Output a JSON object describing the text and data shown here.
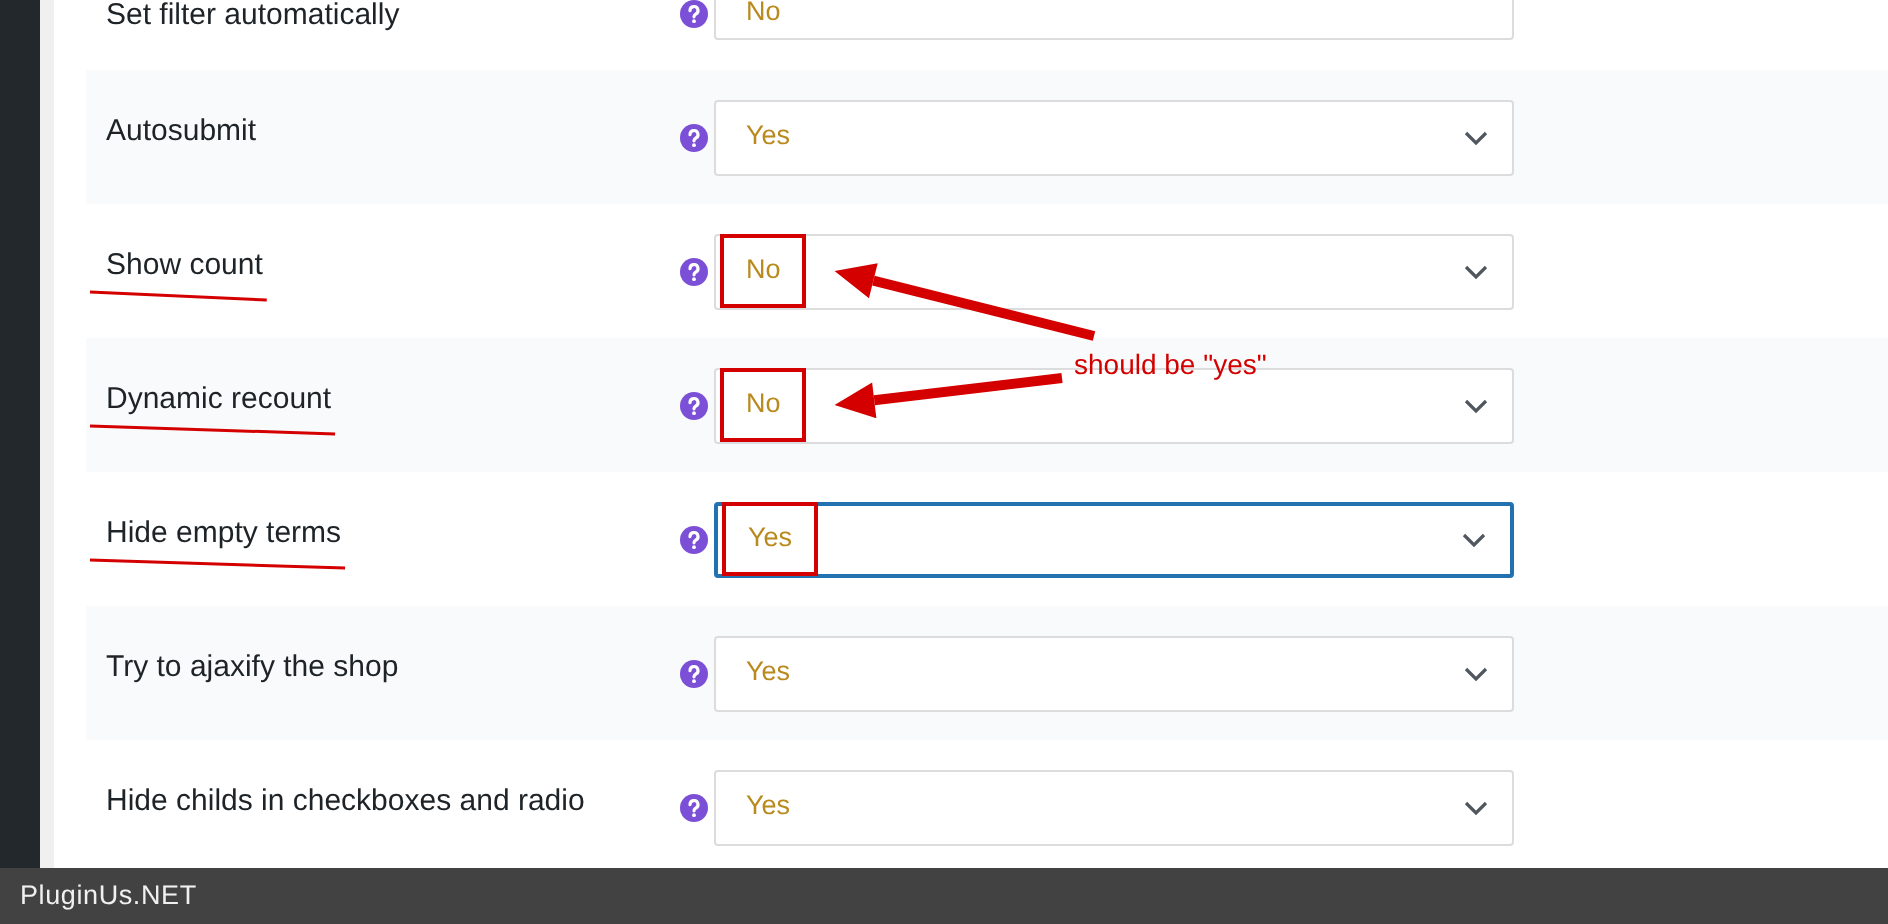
{
  "settings": [
    {
      "label": "Set filter automatically",
      "value": "No",
      "focused": false,
      "underlined": false,
      "highlighted": false,
      "arrow": false
    },
    {
      "label": "Autosubmit",
      "value": "Yes",
      "focused": false,
      "underlined": false,
      "highlighted": false,
      "arrow": false
    },
    {
      "label": "Show count",
      "value": "No",
      "focused": false,
      "underlined": true,
      "highlighted": true,
      "arrow": true
    },
    {
      "label": "Dynamic recount",
      "value": "No",
      "focused": false,
      "underlined": true,
      "highlighted": true,
      "arrow": true
    },
    {
      "label": "Hide empty terms",
      "value": "Yes",
      "focused": true,
      "underlined": true,
      "highlighted": true,
      "arrow": false
    },
    {
      "label": "Try to ajaxify the shop",
      "value": "Yes",
      "focused": false,
      "underlined": false,
      "highlighted": false,
      "arrow": false
    },
    {
      "label": "Hide childs in checkboxes and radio",
      "value": "Yes",
      "focused": false,
      "underlined": false,
      "highlighted": false,
      "arrow": false
    }
  ],
  "note": {
    "text": "should be \"yes\""
  },
  "footer": {
    "text": "PluginUs.NET"
  }
}
